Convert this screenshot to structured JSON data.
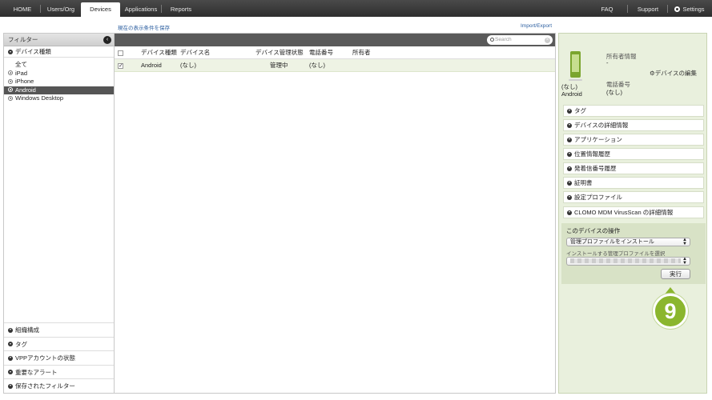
{
  "nav": {
    "tabs": [
      {
        "label": "HOME"
      },
      {
        "label": "Users/Org"
      },
      {
        "label": "Devices"
      },
      {
        "label": "Applications"
      },
      {
        "label": "Reports"
      }
    ],
    "right": {
      "faq": "FAQ",
      "support": "Support",
      "settings": "Settings"
    }
  },
  "links": {
    "save_view": "現在の表示条件を保存",
    "import_export": "Import/Export"
  },
  "filter_panel": {
    "title": "フィルター",
    "group_title": "デバイス種類",
    "items": [
      "全て",
      "iPad",
      "iPhone",
      "Android",
      "Windows Desktop"
    ],
    "selected": "Android",
    "bottom_groups": [
      "組織構成",
      "タグ",
      "VPPアカウントの状態",
      "重要なアラート",
      "保存されたフィルター"
    ]
  },
  "device_list": {
    "search_placeholder": "Search",
    "columns": [
      "デバイス種類",
      "デバイス名",
      "デバイス管理状態",
      "電話番号",
      "所有者"
    ],
    "rows": [
      {
        "checked": true,
        "type": "Android",
        "name": "(なし)",
        "status": "管理中",
        "phone": "(なし)",
        "owner": ""
      }
    ]
  },
  "detail": {
    "device_name": "(なし)",
    "device_type": "Android",
    "owner_label": "所有者情報",
    "owner_value": "-",
    "edit_link": "デバイスの編集",
    "phone_label": "電話番号",
    "phone_value": "(なし)",
    "sections": [
      "タグ",
      "デバイスの詳細情報",
      "アプリケーション",
      "位置情報履歴",
      "発着信番号履歴",
      "証明書",
      "設定プロファイル",
      "CLOMO MDM VirusScan の詳細情報"
    ],
    "ops": {
      "title": "このデバイスの操作",
      "action_value": "管理プロファイルをインストール",
      "profile_label": "インストールする管理プロファイルを選択",
      "run_label": "実行"
    }
  },
  "callout": {
    "number": "9"
  },
  "colors": {
    "accent_green": "#8bb62e",
    "nav_bg": "#3a3a3a",
    "detail_bg": "#e9f0dd"
  }
}
